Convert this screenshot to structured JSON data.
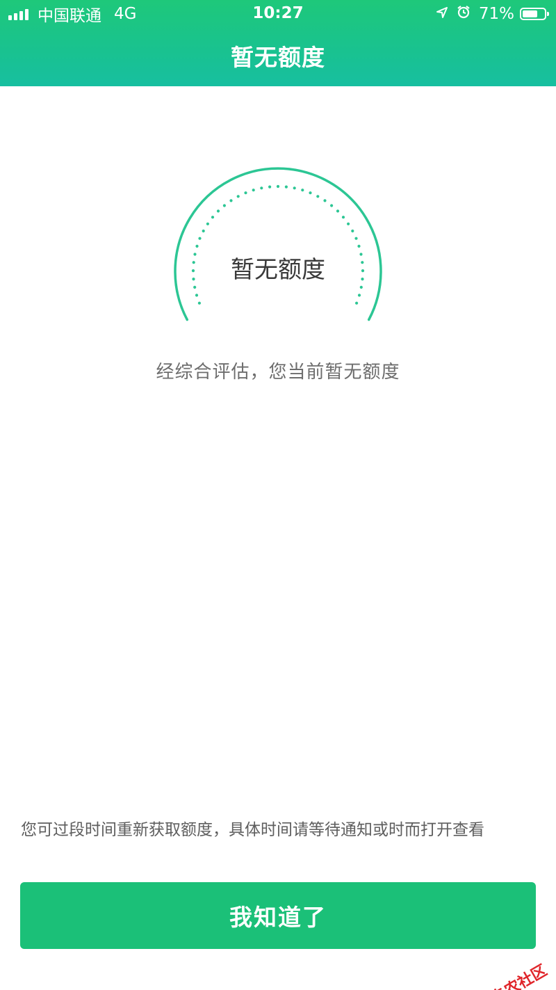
{
  "status_bar": {
    "carrier": "中国联通",
    "network": "4G",
    "time": "10:27",
    "battery_percent_label": "71%",
    "battery_level": 0.71,
    "icons": [
      "signal-icon",
      "location-arrow-icon",
      "alarm-icon",
      "battery-icon"
    ]
  },
  "header": {
    "title": "暂无额度"
  },
  "gauge": {
    "label": "暂无额度",
    "accent_color": "#2cc694"
  },
  "main": {
    "evaluation_text": "经综合评估，您当前暂无额度",
    "hint_text": "您可过段时间重新获取额度，具体时间请等待通知或时而打开查看"
  },
  "footer": {
    "confirm_label": "我知道了",
    "button_color": "#1bc078"
  },
  "watermark": {
    "text": "卡农社区",
    "color": "#e0262b"
  }
}
